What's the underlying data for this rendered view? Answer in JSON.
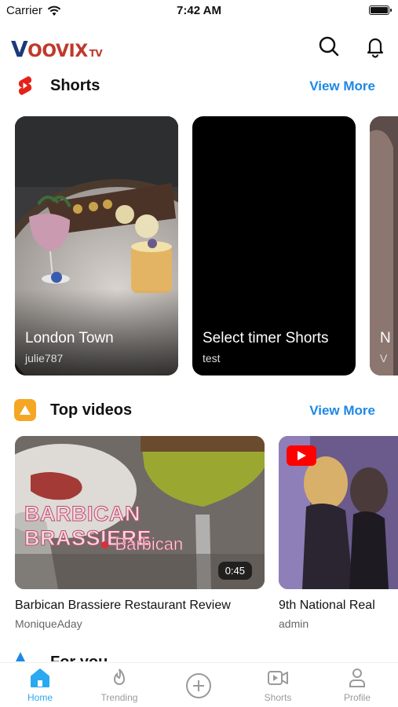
{
  "status_bar": {
    "carrier": "Carrier",
    "time": "7:42 AM"
  },
  "header": {
    "logo_main": "OOVIX",
    "logo_v": "V",
    "logo_suffix": "TV",
    "icons": [
      "search-icon",
      "bell-icon"
    ]
  },
  "shorts": {
    "title": "Shorts",
    "view_more": "View More",
    "items": [
      {
        "title": "London Town",
        "author": "julie787"
      },
      {
        "title": "Select timer Shorts",
        "author": "test"
      },
      {
        "title": "N",
        "author": "V"
      }
    ]
  },
  "top_videos": {
    "title": "Top videos",
    "view_more": "View More",
    "items": [
      {
        "title": "Barbican Brassiere Restaurant Review",
        "author": "MoniqueAday",
        "duration": "0:45",
        "overlay_title": "BARBICAN BRASSIERE",
        "overlay_location": "Barbican"
      },
      {
        "title": "9th National Real",
        "author": "admin"
      }
    ]
  },
  "next_section": {
    "title": "For you"
  },
  "tab_bar": {
    "active": "Home",
    "tabs": [
      {
        "label": "Home",
        "icon": "home-icon"
      },
      {
        "label": "Trending",
        "icon": "flame-icon"
      },
      {
        "label": "",
        "icon": "plus-circle-icon"
      },
      {
        "label": "Shorts",
        "icon": "video-camera-icon"
      },
      {
        "label": "Profile",
        "icon": "user-icon"
      }
    ]
  },
  "colors": {
    "accent": "#1e88e5",
    "active_tab": "#2aa9f0",
    "shorts_red": "#e62117",
    "top_videos_orange": "#f5a623"
  }
}
